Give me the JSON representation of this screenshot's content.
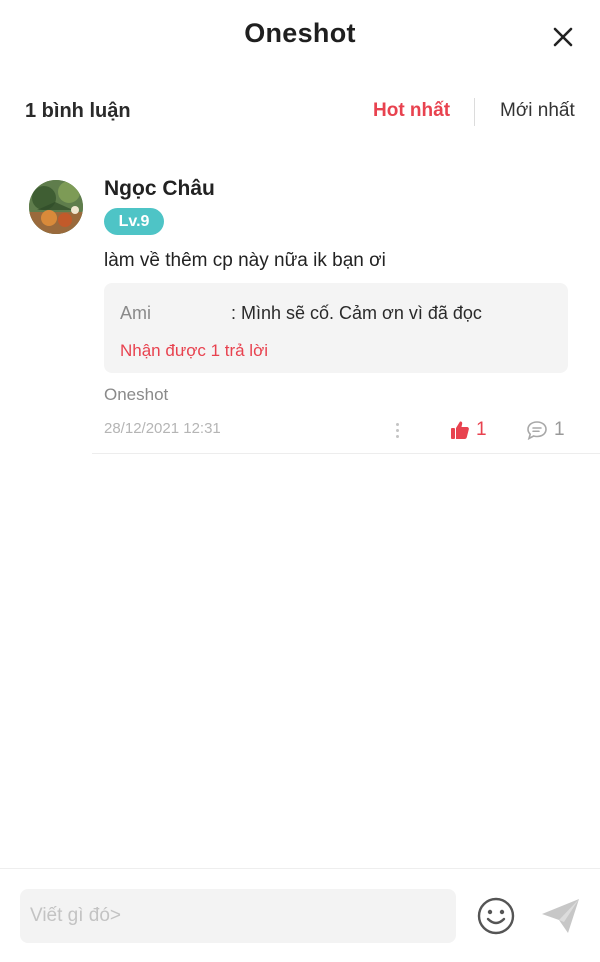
{
  "header": {
    "title": "Oneshot",
    "close_icon": "close-icon"
  },
  "comments_bar": {
    "count_label": "1 bình luận",
    "sort_hot": "Hot nhất",
    "sort_new": "Mới nhất",
    "active_sort": "Hot nhất"
  },
  "comment": {
    "username": "Ngọc Châu",
    "level": "Lv.9",
    "text": "làm về thêm cp này nữa ik bạn ơi",
    "reply_preview": {
      "author": "Ami",
      "text": ": Mình sẽ cố. Cảm ơn vì đã đọc",
      "reply_count_label": "Nhận được 1 trả lời"
    },
    "story_name": "Oneshot",
    "timestamp": "28/12/2021 12:31",
    "like_count": "1",
    "reply_count": "1"
  },
  "composer": {
    "placeholder": "Viết gì đó>",
    "emoji_icon": "smiley-icon",
    "send_icon": "send-icon"
  },
  "colors": {
    "accent_red": "#e8424f",
    "level_teal": "#4ec4c6",
    "muted_gray": "#8a8a8a"
  }
}
